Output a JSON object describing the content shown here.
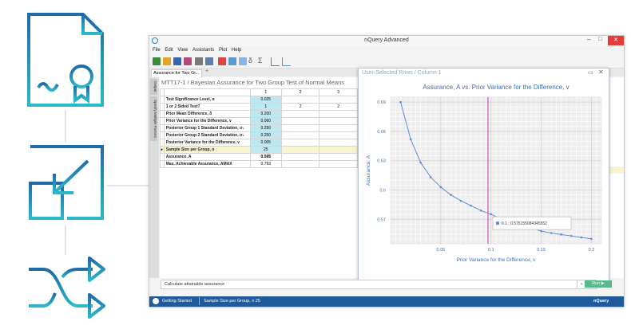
{
  "window": {
    "title": "nQuery Advanced"
  },
  "menu": [
    "File",
    "Edit",
    "View",
    "Assistants",
    "Plot",
    "Help"
  ],
  "tab": {
    "label": "Assurance for Two Gr..."
  },
  "sidebar_tabs": [
    "Output",
    "Specify Multiple Factors"
  ],
  "main": {
    "title": "MTT17-1 / Bayesian Assurance for Two Group Test of Normal Means",
    "columns": [
      "1",
      "2",
      "3"
    ],
    "rows": [
      {
        "label": "Test Significance Level, α",
        "v1": "0.025",
        "v2": "",
        "v3": ""
      },
      {
        "label": "1 or 2 Sided Test?",
        "v1": "1",
        "v2": "2",
        "v3": "2"
      },
      {
        "label": "Prior Mean Difference, δ",
        "v1": "0.200",
        "v2": "",
        "v3": ""
      },
      {
        "label": "Prior Variance for the Difference, v",
        "v1": "0.060",
        "v2": "",
        "v3": ""
      },
      {
        "label": "Posterior Group 1 Standard Deviation, σ₁",
        "v1": "0.250",
        "v2": "",
        "v3": ""
      },
      {
        "label": "Posterior Group 2 Standard Deviation, σ₂",
        "v1": "0.250",
        "v2": "",
        "v3": ""
      },
      {
        "label": "Posterior Variance for the Difference, v",
        "v1": "0.005",
        "v2": "",
        "v3": ""
      },
      {
        "label": "Sample Size per Group, n",
        "v1": "25",
        "v2": "",
        "v3": ""
      },
      {
        "label": "Assurance, A",
        "v1": "0.595",
        "v2": "",
        "v3": ""
      },
      {
        "label": "Max. Achievable Assurance, AMAX",
        "v1": "0.793",
        "v2": "",
        "v3": ""
      }
    ]
  },
  "panel": {
    "title": "User-Selected Rows / Column 1"
  },
  "command": {
    "text": "Calculate attainable assurance",
    "run_label": "Run ▶"
  },
  "status": {
    "left": "Getting Started",
    "middle": "Sample Size per Group, n 25",
    "brand": "nQuery"
  },
  "chart_data": {
    "type": "line",
    "title": "Assurance, A vs. Prior Variance for the Difference, v",
    "xlabel": "Prior Variance for the Difference, v",
    "ylabel": "Assurance, A",
    "xlim": [
      0,
      0.21
    ],
    "ylim": [
      0.545,
      0.695
    ],
    "xticks": [
      "0.05",
      "0.1",
      "0.15",
      "0.2"
    ],
    "yticks": [
      "0.57",
      "0.6",
      "0.63",
      "0.66",
      "0.69"
    ],
    "x": [
      0.01,
      0.02,
      0.03,
      0.04,
      0.05,
      0.06,
      0.07,
      0.08,
      0.09,
      0.1,
      0.11,
      0.12,
      0.13,
      0.14,
      0.15,
      0.16,
      0.17,
      0.18,
      0.19,
      0.2
    ],
    "y": [
      0.69,
      0.652,
      0.628,
      0.613,
      0.603,
      0.595,
      0.589,
      0.584,
      0.579,
      0.5752,
      0.5705,
      0.567,
      0.564,
      0.561,
      0.558,
      0.556,
      0.5545,
      0.553,
      0.5515,
      0.55
    ],
    "marker_x": 0.097,
    "tooltip": "0.1 : 0.575155084345552",
    "colors": {
      "line": "#5b8fd6",
      "marker": "#c43ab8"
    }
  }
}
